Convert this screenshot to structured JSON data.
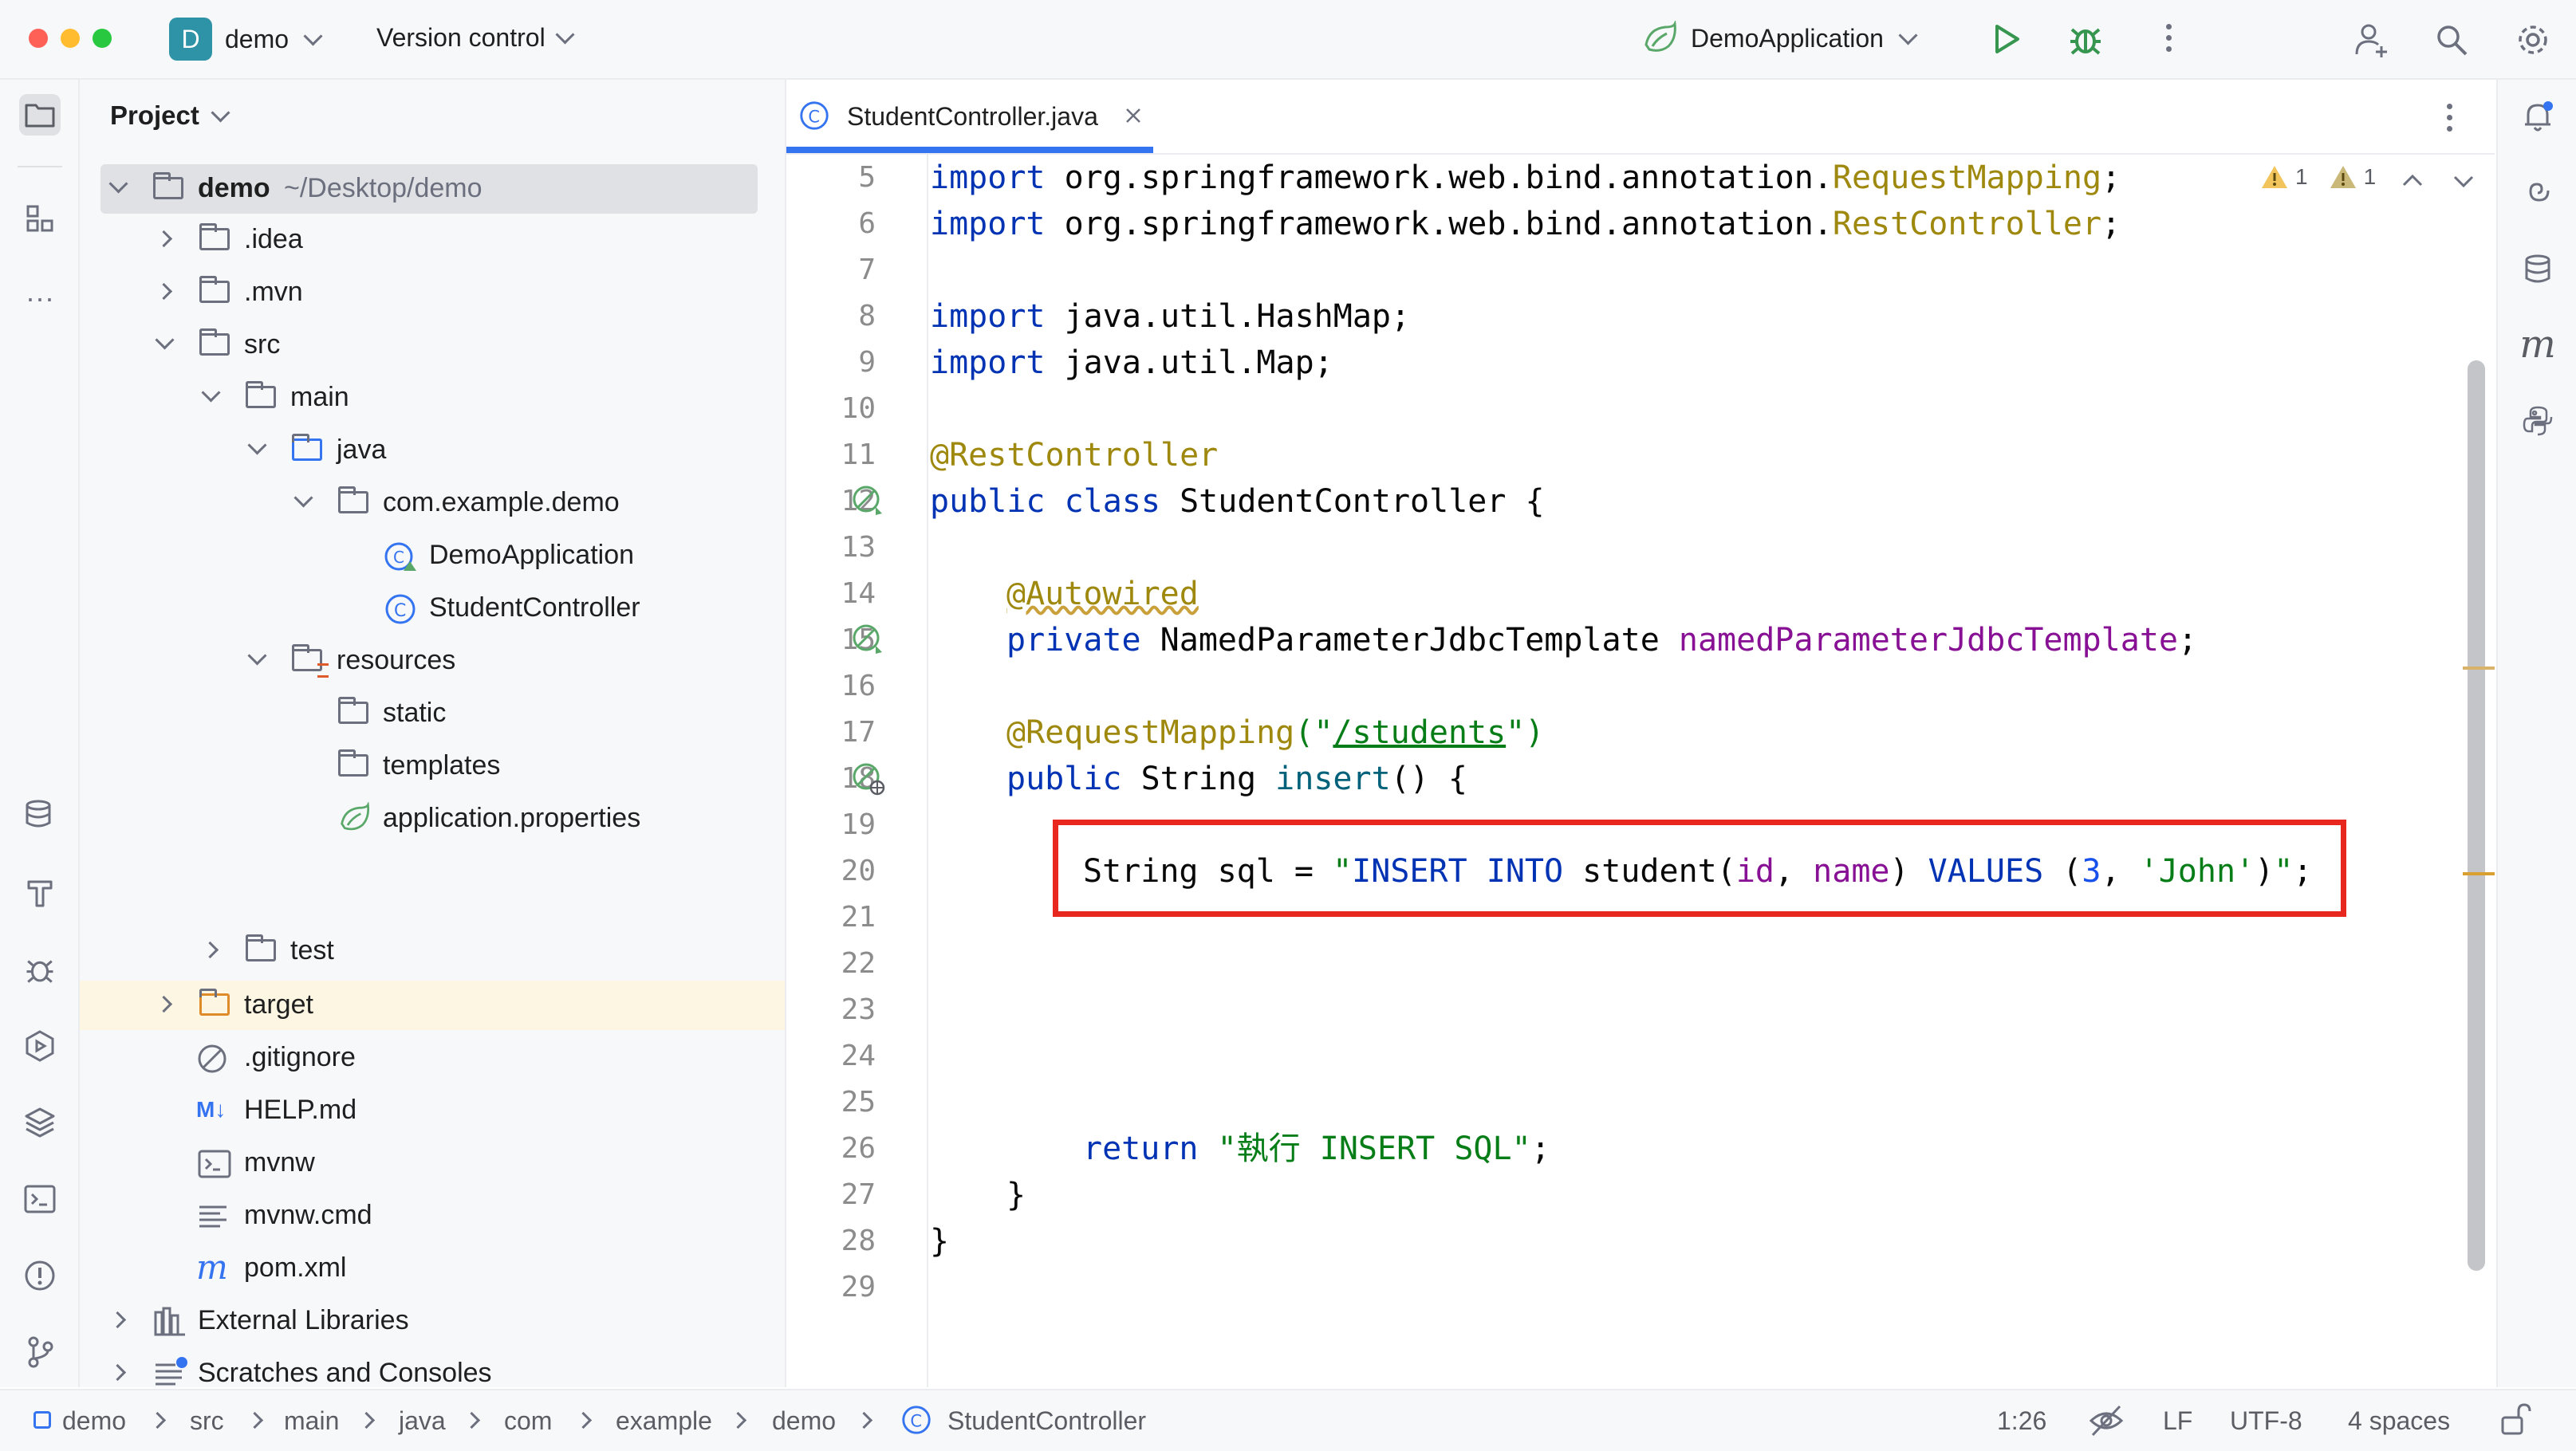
{
  "titlebar": {
    "project_badge": "D",
    "project_name": "demo",
    "vcs": "Version control",
    "run_config": "DemoApplication"
  },
  "project_panel": {
    "title": "Project",
    "root_name": "demo",
    "root_path": "~/Desktop/demo",
    "items": [
      {
        "label": ".idea"
      },
      {
        "label": ".mvn"
      },
      {
        "label": "src"
      },
      {
        "label": "main"
      },
      {
        "label": "java"
      },
      {
        "label": "com.example.demo"
      },
      {
        "label": "DemoApplication"
      },
      {
        "label": "StudentController"
      },
      {
        "label": "resources"
      },
      {
        "label": "static"
      },
      {
        "label": "templates"
      },
      {
        "label": "application.properties"
      },
      {
        "label": "test"
      },
      {
        "label": "target"
      },
      {
        "label": ".gitignore"
      },
      {
        "label": "HELP.md"
      },
      {
        "label": "mvnw"
      },
      {
        "label": "mvnw.cmd"
      },
      {
        "label": "pom.xml"
      },
      {
        "label": "External Libraries"
      },
      {
        "label": "Scratches and Consoles"
      }
    ]
  },
  "editor": {
    "tab_label": "StudentController.java",
    "inspections": {
      "warnings_a": "1",
      "warnings_b": "1"
    },
    "line_numbers": [
      "5",
      "6",
      "7",
      "8",
      "9",
      "10",
      "11",
      "12",
      "13",
      "14",
      "15",
      "16",
      "17",
      "18",
      "19",
      "20",
      "21",
      "22",
      "23",
      "24",
      "25",
      "26",
      "27",
      "28",
      "29"
    ],
    "code": {
      "l5_kw": "import",
      "l5_pkg": " org.springframework.web.bind.annotation.",
      "l5_cls": "RequestMapping",
      "l5_end": ";",
      "l6_kw": "import",
      "l6_pkg": " org.springframework.web.bind.annotation.",
      "l6_cls": "RestController",
      "l6_end": ";",
      "l8_kw": "import",
      "l8_rest": " java.util.HashMap;",
      "l9_kw": "import",
      "l9_rest": " java.util.Map;",
      "l11": "@RestController",
      "l12_kw": "public class",
      "l12_rest": " StudentController {",
      "l14": "@Autowired",
      "l15_kw": "private",
      "l15_type": " NamedParameterJdbcTemplate ",
      "l15_fld": "namedParameterJdbcTemplate",
      "l15_end": ";",
      "l17_ann": "@RequestMapping",
      "l17_open": "(\"",
      "l17_path": "/students",
      "l17_close": "\")",
      "l18_kw": "public",
      "l18_type": " String ",
      "l18_fn": "insert",
      "l18_end": "() {",
      "l20_a": "String sql = ",
      "l20_q1": "\"",
      "l20_b": "INSERT INTO",
      "l20_c": " student(",
      "l20_d": "id",
      "l20_e": ", ",
      "l20_f": "name",
      "l20_g": ") ",
      "l20_h": "VALUES",
      "l20_i": " (",
      "l20_j": "3",
      "l20_k": ", ",
      "l20_l": "'John'",
      "l20_m": ")",
      "l20_q2": "\"",
      "l20_n": ";",
      "l26_kw": "return",
      "l26_str": " \"執行 INSERT SQL\"",
      "l26_end": ";",
      "l27": "}",
      "l28": "}"
    }
  },
  "breadcrumb": [
    "demo",
    "src",
    "main",
    "java",
    "com",
    "example",
    "demo",
    "StudentController"
  ],
  "status": {
    "position": "1:26",
    "line_sep": "LF",
    "encoding": "UTF-8",
    "indent": "4 spaces"
  },
  "colors": {
    "accent": "#3574f0",
    "highlight_box": "#e8281e",
    "keyword": "#0033b3",
    "annotation": "#9e880d",
    "string": "#067d17",
    "field": "#871094"
  }
}
